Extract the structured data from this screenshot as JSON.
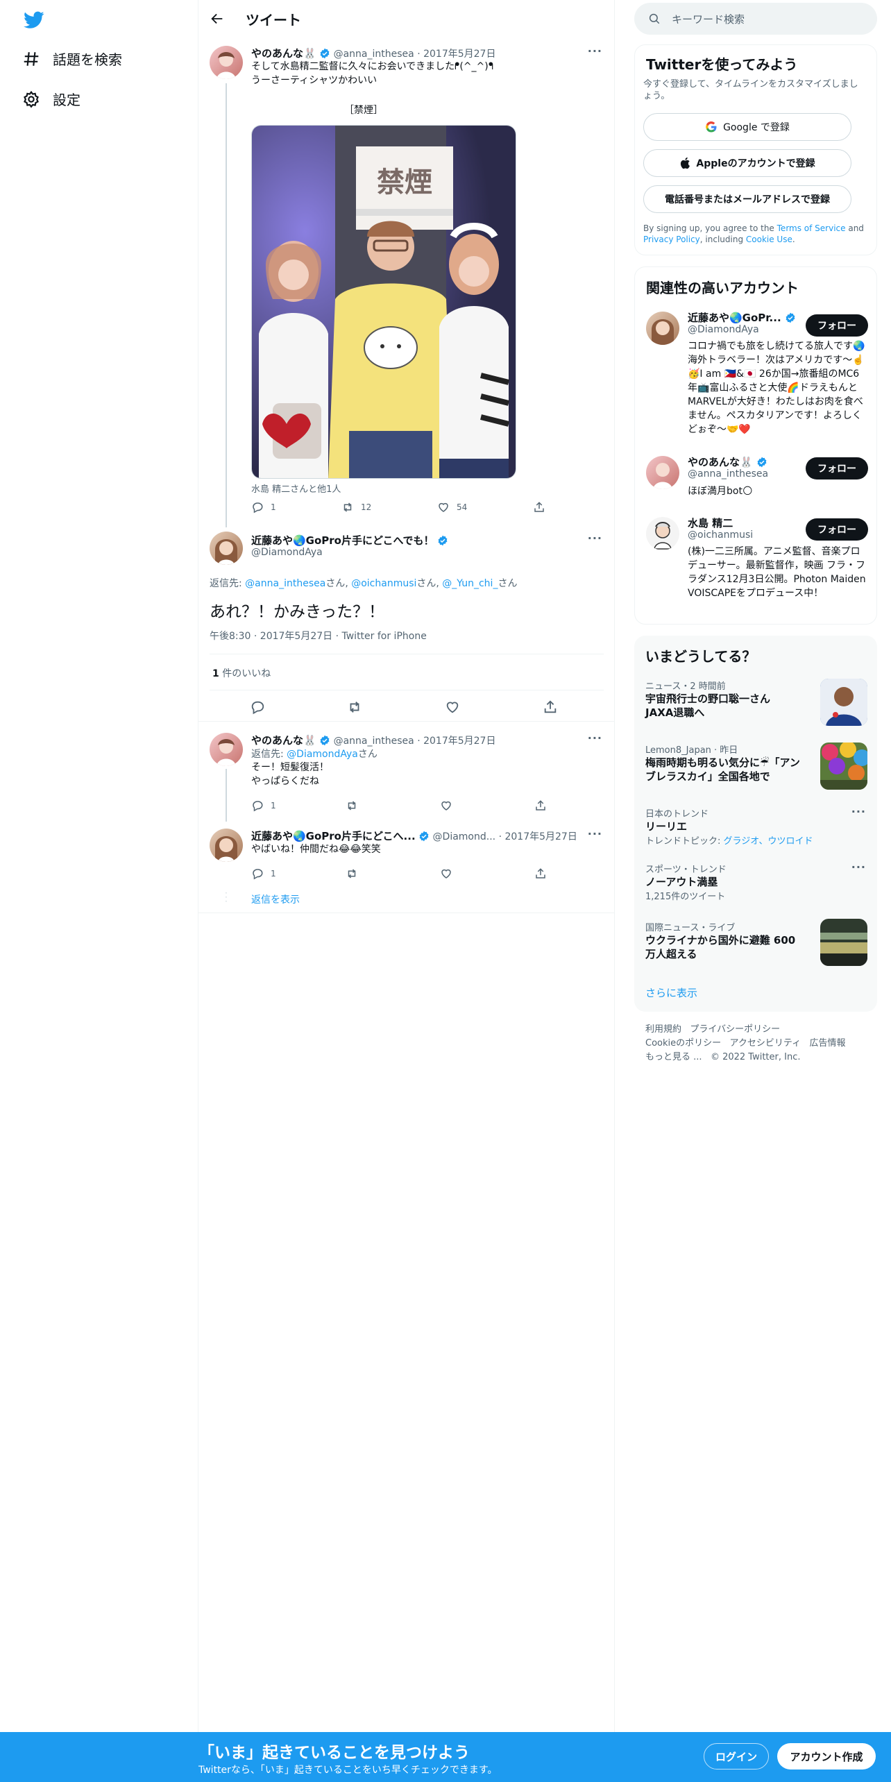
{
  "nav": {
    "explore_label": "話題を検索",
    "settings_label": "設定"
  },
  "header": {
    "title": "ツイート"
  },
  "tweet1": {
    "name": "やのあんな🐰",
    "handle": "@anna_inthesea",
    "date": "2017年5月27日",
    "text_line1": "そして水島精二監督に久々にお会いできましたᖰ(^_^)ᖳ",
    "text_line2": "うーさーティシャツかわいい",
    "image_sign": "禁煙",
    "image_caption_top": "［禁煙］",
    "tag_text": "水島 精二さんと他1人",
    "reply_count": "1",
    "retweet_count": "12",
    "like_count": "54"
  },
  "main_tweet": {
    "name": "近藤あや🌏GoPro片手にどこへでも！",
    "handle": "@DiamondAya",
    "reply_prefix": "返信先: ",
    "reply_to": [
      "@anna_inthesea",
      "@oichanmusi",
      "@_Yun_chi_"
    ],
    "reply_suffix": "さん",
    "text": "あれ？！かみきった？！",
    "time": "午後8:30 · 2017年5月27日 · Twitter for iPhone",
    "likes_num": "1",
    "likes_label": " 件のいいね"
  },
  "reply1": {
    "name": "やのあんな🐰",
    "handle": "@anna_inthesea",
    "date": "2017年5月27日",
    "reply_prefix": "返信先: ",
    "reply_to": "@DiamondAya",
    "reply_suffix": "さん",
    "text_line1": "そー！短髪復活！",
    "text_line2": "やっぱらくだね",
    "reply_count": "1"
  },
  "reply2": {
    "name": "近藤あや🌏GoPro片手にどこへ...",
    "handle": "@Diamond...",
    "date": "2017年5月27日",
    "text": "やばいね！仲間だね😂😂笑笑",
    "reply_count": "1",
    "show_replies": "返信を表示"
  },
  "search": {
    "placeholder": "キーワード検索"
  },
  "signup": {
    "title": "Twitterを使ってみよう",
    "subtitle": "今すぐ登録して、タイムラインをカスタマイズしましょう。",
    "google": "Google で登録",
    "apple": "Appleのアカウントで登録",
    "phone": "電話番号またはメールアドレスで登録",
    "terms_pre": "By signing up, you agree to the ",
    "terms": "Terms of Service",
    "terms_and": " and ",
    "privacy": "Privacy Policy",
    "terms_incl": ", including ",
    "cookie": "Cookie Use",
    "period": "."
  },
  "related": {
    "title": "関連性の高いアカウント",
    "follow": "フォロー",
    "accounts": [
      {
        "name": "近藤あや🌏GoPr...",
        "handle": "@DiamondAya",
        "bio": "コロナ禍でも旅をし続けてる旅人です🌏海外トラベラー！次はアメリカです〜☝️🥳I am 🇵🇭&🇯🇵 26か国→旅番組のMC6年📺富山ふるさと大使🌈ドラえもんとMARVELが大好き！わたしはお肉を食べません。ペスカタリアンです！よろしくどぉぞ〜🤝❤️"
      },
      {
        "name": "やのあんな🐰",
        "handle": "@anna_inthesea",
        "bio": "ほぼ満月bot🌕"
      },
      {
        "name": "水島 精二",
        "handle": "@oichanmusi",
        "bio": "(株)一二三所属。アニメ監督、音楽プロデューサー。最新監督作，映画 フラ・フラダンス12月3日公開。Photon Maiden VOISCAPEをプロデュース中！"
      }
    ]
  },
  "trends": {
    "title": "いまどうしてる？",
    "items": [
      {
        "cat": "ニュース・2 時間前",
        "title": "宇宙飛行士の野口聡一さんJAXA退職へ"
      },
      {
        "cat": "Lemon8_Japan · 昨日",
        "title": "梅雨時期も明るい気分に☔「アンブレラスカイ」全国各地で"
      },
      {
        "cat": "日本のトレンド",
        "title": "リーリエ",
        "sub_label": "トレンドトピック: ",
        "sub_links": "グラジオ、ウツロイド"
      },
      {
        "cat": "スポーツ・トレンド",
        "title": "ノーアウト満塁",
        "sub": "1,215件のツイート"
      },
      {
        "cat": "国際ニュース・ライブ",
        "title": "ウクライナから国外に避難 600万人超える"
      }
    ],
    "more": "さらに表示"
  },
  "footer": {
    "terms": "利用規約",
    "privacy": "プライバシーポリシー",
    "cookie": "Cookieのポリシー",
    "access": "アクセシビリティ",
    "ads": "広告情報",
    "more": "もっと見る ...",
    "copy": "© 2022 Twitter, Inc."
  },
  "bottom": {
    "title": "「いま」起きていることを見つけよう",
    "subtitle": "Twitterなら、「いま」起きていることをいち早くチェックできます。",
    "login": "ログイン",
    "signup": "アカウント作成"
  },
  "colors": {
    "accent": "#1d9bf0",
    "text": "#0f1419",
    "secondary": "#536471"
  }
}
